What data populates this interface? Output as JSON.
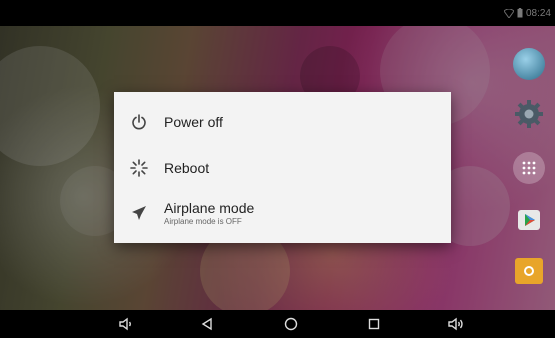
{
  "status_bar": {
    "time": "08:24",
    "icons": [
      "wifi-icon",
      "battery-icon"
    ]
  },
  "power_menu": {
    "items": [
      {
        "label": "Power off",
        "icon": "power-icon"
      },
      {
        "label": "Reboot",
        "icon": "reboot-spinner-icon"
      },
      {
        "label": "Airplane mode",
        "sublabel": "Airplane mode is OFF",
        "icon": "airplane-icon"
      }
    ]
  },
  "navigation_bar": {
    "buttons": [
      "volume-down-icon",
      "back-icon",
      "home-icon",
      "recents-icon",
      "volume-up-icon"
    ]
  },
  "home_dock": {
    "icons": [
      "browser-globe-icon",
      "settings-gear-icon",
      "app-drawer-icon",
      "play-store-icon",
      "file-manager-icon"
    ]
  },
  "colors": {
    "dialog_background": "#f3f3f3",
    "status_bar": "#000000",
    "nav_bar": "#000000",
    "text_primary": "#222222",
    "text_secondary": "#666666"
  }
}
